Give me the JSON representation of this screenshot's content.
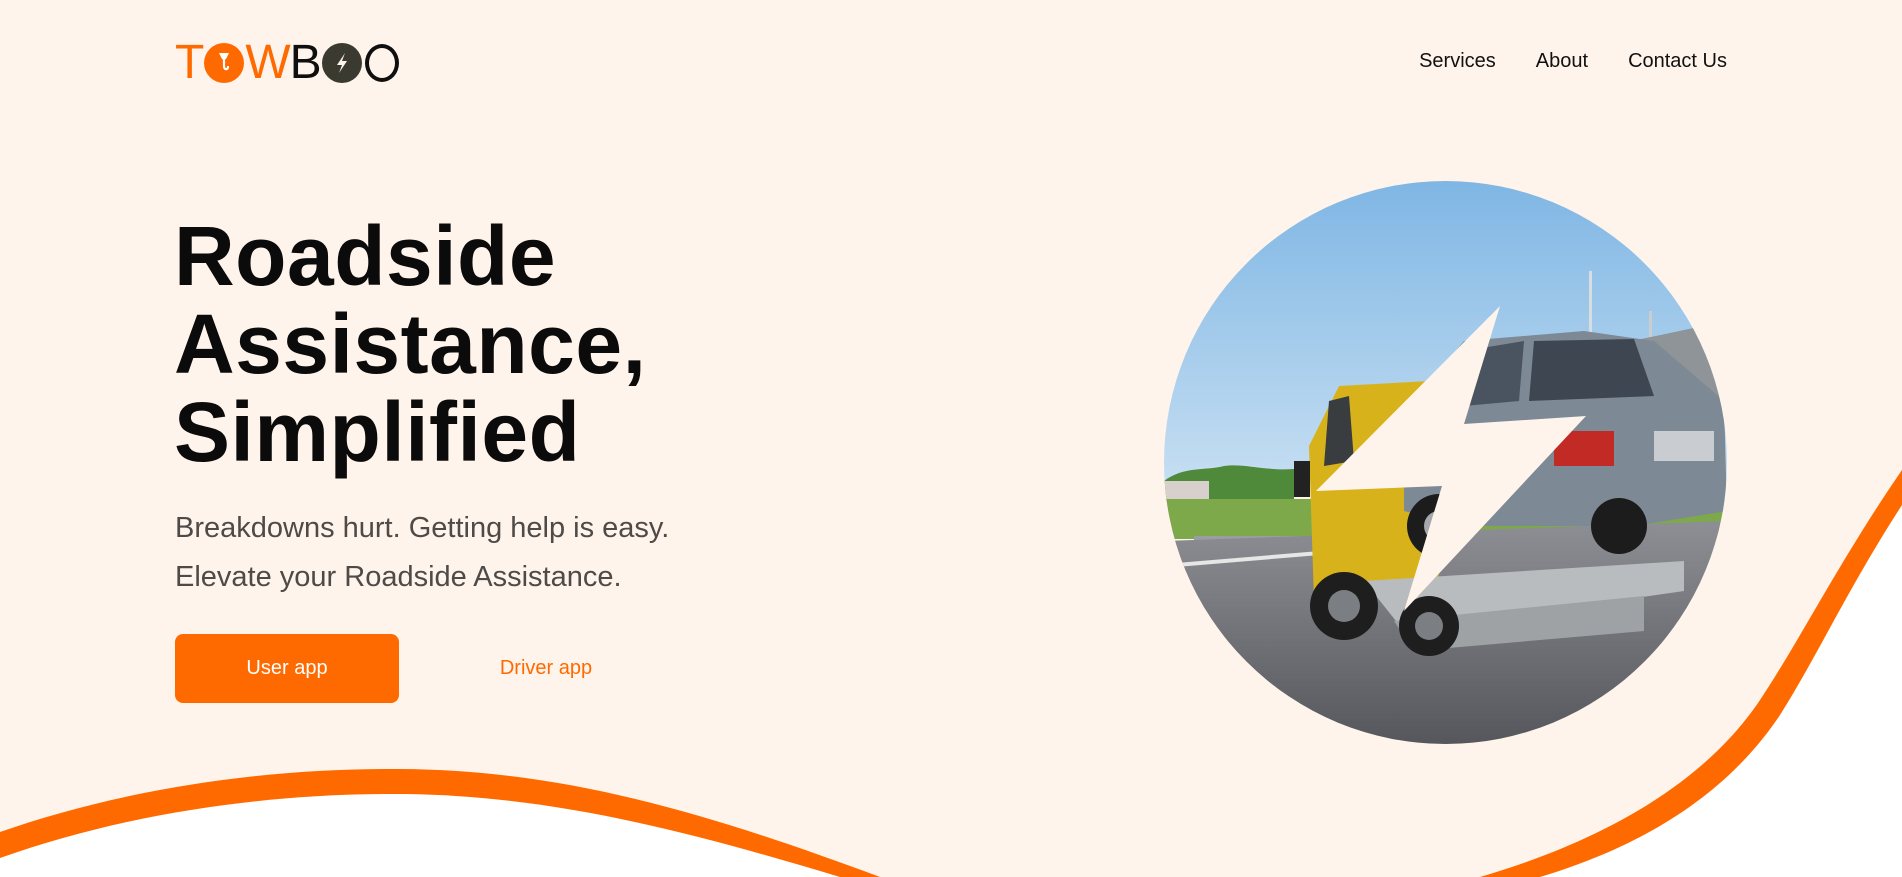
{
  "brand": {
    "logo_text": "TOWBOO",
    "primary_color": "#ff6a00",
    "dark_color": "#0f0f0f",
    "background_color": "#fff4eb"
  },
  "nav": {
    "items": [
      {
        "label": "Services"
      },
      {
        "label": "About"
      },
      {
        "label": "Contact Us"
      }
    ]
  },
  "hero": {
    "title_lines": [
      "Roadside",
      "Assistance,",
      "Simplified"
    ],
    "subtitle_lines": [
      "Breakdowns hurt. Getting help is easy.",
      "Elevate your Roadside Assistance."
    ],
    "primary_button": "User app",
    "secondary_button": "Driver app",
    "image_icon": "lightning-bolt-icon"
  }
}
